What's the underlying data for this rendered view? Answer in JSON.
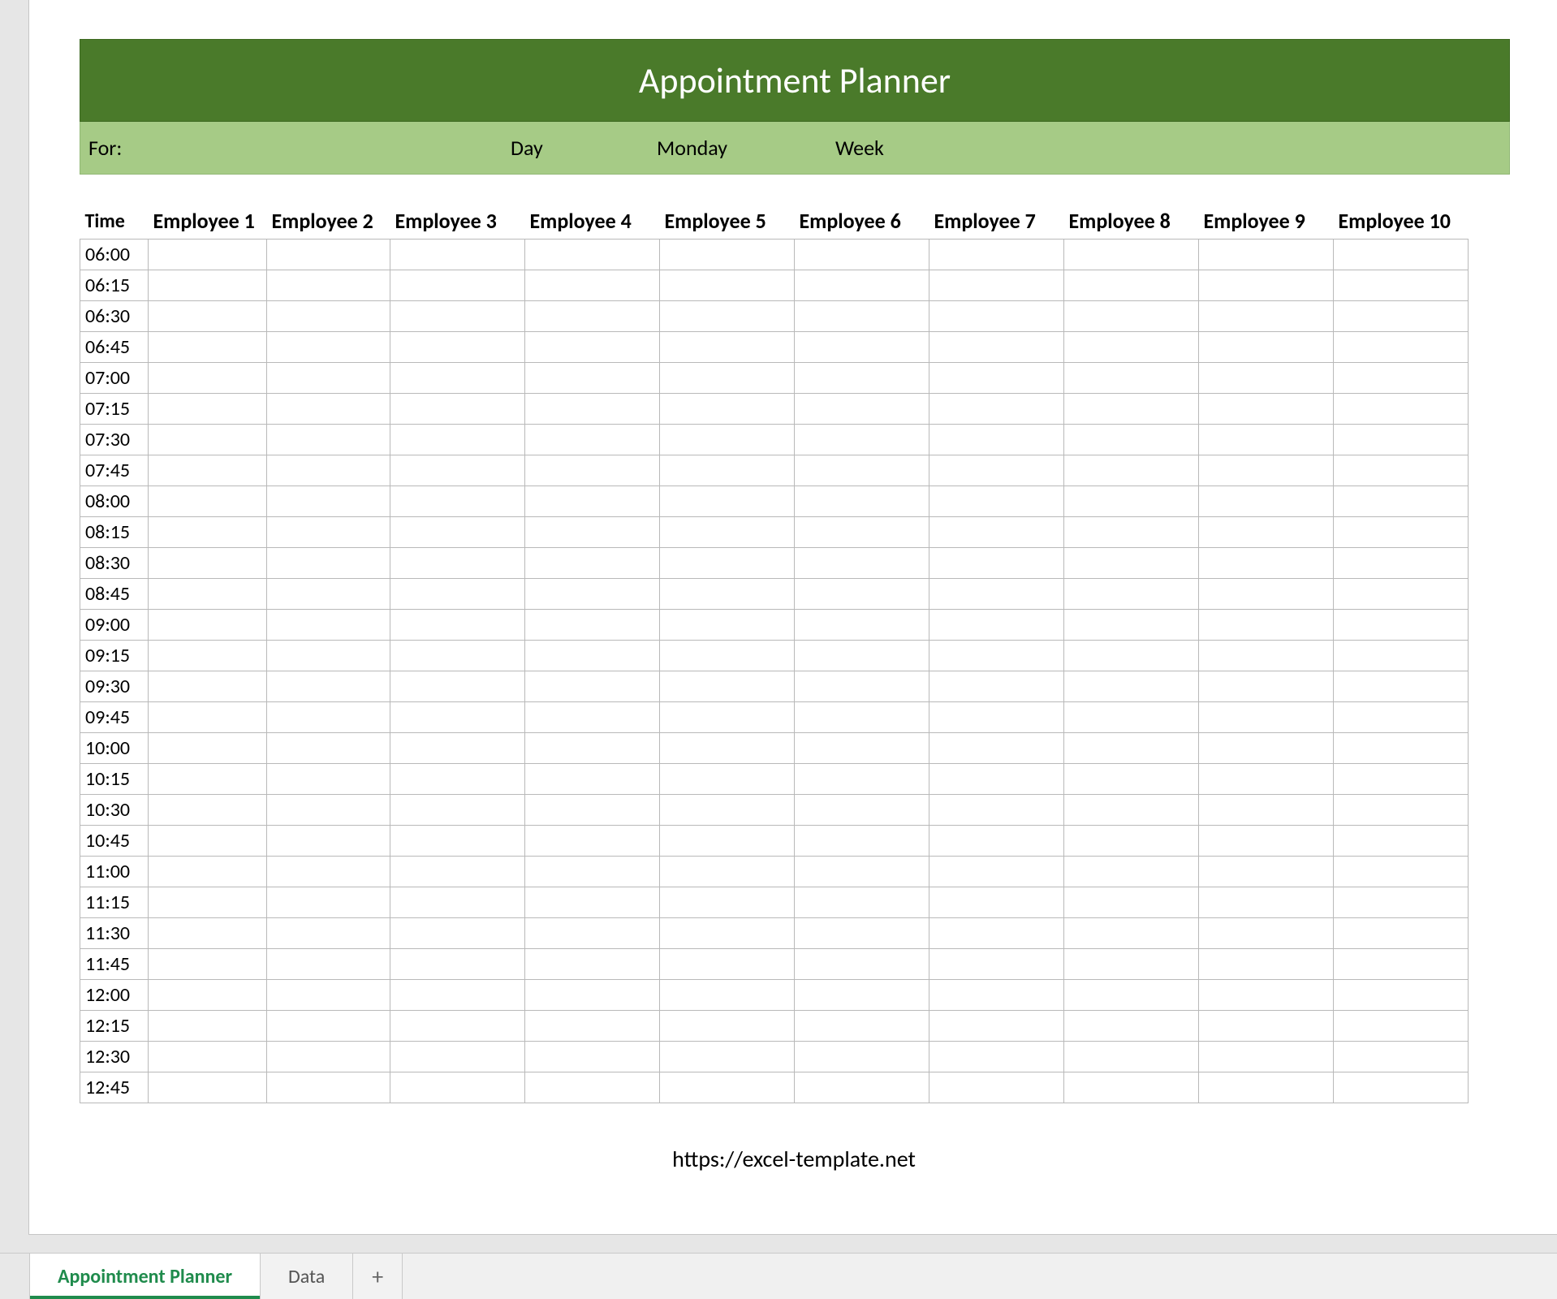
{
  "title": "Appointment Planner",
  "info_bar": {
    "for_label": "For:",
    "day_label": "Day",
    "day_value": "Monday",
    "week_label": "Week"
  },
  "columns": [
    "Time",
    "Employee 1",
    "Employee 2",
    "Employee 3",
    "Employee 4",
    "Employee 5",
    "Employee 6",
    "Employee 7",
    "Employee 8",
    "Employee 9",
    "Employee 10"
  ],
  "times": [
    "06:00",
    "06:15",
    "06:30",
    "06:45",
    "07:00",
    "07:15",
    "07:30",
    "07:45",
    "08:00",
    "08:15",
    "08:30",
    "08:45",
    "09:00",
    "09:15",
    "09:30",
    "09:45",
    "10:00",
    "10:15",
    "10:30",
    "10:45",
    "11:00",
    "11:15",
    "11:30",
    "11:45",
    "12:00",
    "12:15",
    "12:30",
    "12:45"
  ],
  "footer_url": "https://excel-template.net",
  "tabs": {
    "active": "Appointment Planner",
    "others": [
      "Data"
    ],
    "add": "+"
  },
  "colors": {
    "banner": "#4a7a2a",
    "info_bar": "#a6cb86",
    "tab_active_accent": "#1f8b4c"
  }
}
